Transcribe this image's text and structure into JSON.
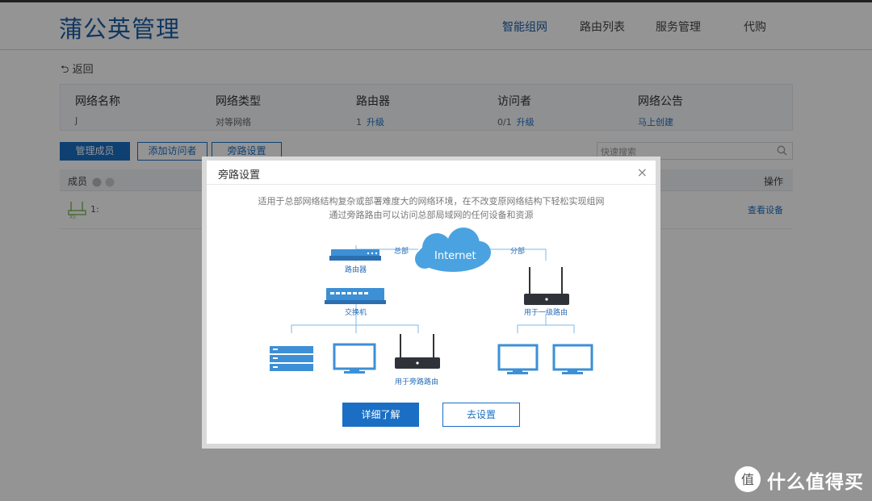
{
  "header": {
    "logo": "蒲公英管理",
    "nav": [
      {
        "label": "智能组网",
        "active": true
      },
      {
        "label": "路由列表",
        "active": false
      },
      {
        "label": "服务管理",
        "active": false
      },
      {
        "label": "代购",
        "active": false
      }
    ]
  },
  "back": {
    "label": "返回"
  },
  "info": {
    "columns": [
      {
        "title": "网络名称",
        "value": "J",
        "link": ""
      },
      {
        "title": "网络类型",
        "value": "对等网络",
        "link": ""
      },
      {
        "title": "路由器",
        "value": "1",
        "link": "升级"
      },
      {
        "title": "访问者",
        "value": "0/1",
        "link": "升级"
      },
      {
        "title": "网络公告",
        "value": "",
        "link": "马上创建"
      }
    ]
  },
  "tabs": [
    {
      "label": "管理成员",
      "active": true
    },
    {
      "label": "添加访问者",
      "active": false
    },
    {
      "label": "旁路设置",
      "active": false
    }
  ],
  "search": {
    "placeholder": "快速搜索"
  },
  "table": {
    "member_header": "成员",
    "ops_header": "操作",
    "row": {
      "name": "1:",
      "action": "查看设备"
    }
  },
  "modal": {
    "title": "旁路设置",
    "close": "×",
    "desc_line1": "适用于总部网络结构复杂或部署难度大的网络环境，在不改变原网络结构下轻松实现组网",
    "desc_line2": "通过旁路路由可以访问总部局域网的任何设备和资源",
    "diagram": {
      "cloud": "Internet",
      "hq": "总部",
      "branch": "分部",
      "router": "路由器",
      "switch": "交换机",
      "bypass_router": "用于旁路路由",
      "level1_router": "用于一级路由"
    },
    "primary_button": "详细了解",
    "secondary_button": "去设置"
  },
  "watermark": {
    "text": "什么值得买"
  },
  "colors": {
    "accent": "#1a6fc4",
    "logo": "#1a5ea8",
    "diagram_blue": "#4aa3e0"
  }
}
